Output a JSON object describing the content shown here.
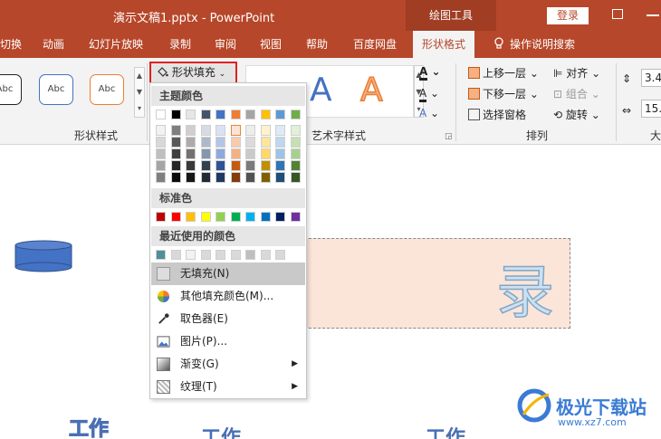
{
  "titlebar": {
    "title": "演示文稿1.pptx  -  PowerPoint",
    "context_tools": "绘图工具",
    "login": "登录"
  },
  "tabs": [
    "切换",
    "动画",
    "幻灯片放映",
    "录制",
    "审阅",
    "视图",
    "帮助",
    "百度网盘",
    "形状格式",
    "操作说明搜索"
  ],
  "active_tab": "形状格式",
  "ribbon": {
    "shape_styles": {
      "label": "形状样式",
      "samples": [
        "Abc",
        "Abc",
        "Abc"
      ]
    },
    "shape_fill": "形状填充",
    "wordart": {
      "label": "艺术字样式",
      "sample": "A"
    },
    "arrange": {
      "label": "排列",
      "bring_forward": "上移一层",
      "send_backward": "下移一层",
      "selection_pane": "选择窗格",
      "align": "对齐",
      "group": "组合",
      "rotate": "旋转"
    },
    "size": {
      "label": "大",
      "height": "3.4",
      "width": "15."
    }
  },
  "fill_menu": {
    "theme_colors_header": "主题颜色",
    "theme_colors": [
      [
        "#ffffff",
        "#000000",
        "#e7e6e6",
        "#44546a",
        "#4472c4",
        "#ed7d31",
        "#a5a5a5",
        "#ffc000",
        "#5b9bd5",
        "#70ad47"
      ],
      [
        "#f2f2f2",
        "#7f7f7f",
        "#d0cece",
        "#d6dce4",
        "#d9e2f3",
        "#fbe4d5",
        "#ededed",
        "#fff2cc",
        "#deebf6",
        "#e2efd9"
      ],
      [
        "#d8d8d8",
        "#595959",
        "#aeaaaa",
        "#adb9ca",
        "#b4c6e7",
        "#f7cbac",
        "#dbdbdb",
        "#fee599",
        "#bdd7ee",
        "#c5e0b3"
      ],
      [
        "#bfbfbf",
        "#3f3f3f",
        "#757070",
        "#8496b0",
        "#8eaadb",
        "#f4b183",
        "#c9c9c9",
        "#ffd965",
        "#9dc3e6",
        "#a8d08d"
      ],
      [
        "#a5a5a5",
        "#262626",
        "#3a3838",
        "#323f4f",
        "#2f5496",
        "#c55a11",
        "#7b7b7b",
        "#bf9000",
        "#2e75b5",
        "#538135"
      ],
      [
        "#7f7f7f",
        "#0c0c0c",
        "#171616",
        "#222a35",
        "#1f3864",
        "#833c0b",
        "#525252",
        "#7f6000",
        "#1e4e79",
        "#375623"
      ]
    ],
    "standard_colors_header": "标准色",
    "standard_colors": [
      "#c00000",
      "#ff0000",
      "#ffc000",
      "#ffff00",
      "#92d050",
      "#00b050",
      "#00b0f0",
      "#0070c0",
      "#002060",
      "#7030a0"
    ],
    "recent_colors_header": "最近使用的颜色",
    "recent_colors": [
      "#4f8f9a",
      "#d9d9d9",
      "#f2f2f2",
      "#d9d9d9",
      "#d9d9d9",
      "#d9d9d9",
      "#bfbfbf",
      "#d9d9d9",
      "#d9d9d9"
    ],
    "items": [
      {
        "label": "无填充(N)",
        "icon": "no-fill-icon"
      },
      {
        "label": "其他填充颜色(M)...",
        "icon": "color-wheel-icon"
      },
      {
        "label": "取色器(E)",
        "icon": "eyedropper-icon"
      },
      {
        "label": "图片(P)...",
        "icon": "picture-icon"
      },
      {
        "label": "渐变(G)",
        "icon": "gradient-icon"
      },
      {
        "label": "纹理(T)",
        "icon": "texture-icon"
      }
    ]
  },
  "slide": {
    "big_char": "录",
    "work_texts": [
      "工作",
      "工作",
      "工作"
    ]
  },
  "watermark": {
    "name": "极光下载站",
    "url": "www.xz7.com"
  }
}
